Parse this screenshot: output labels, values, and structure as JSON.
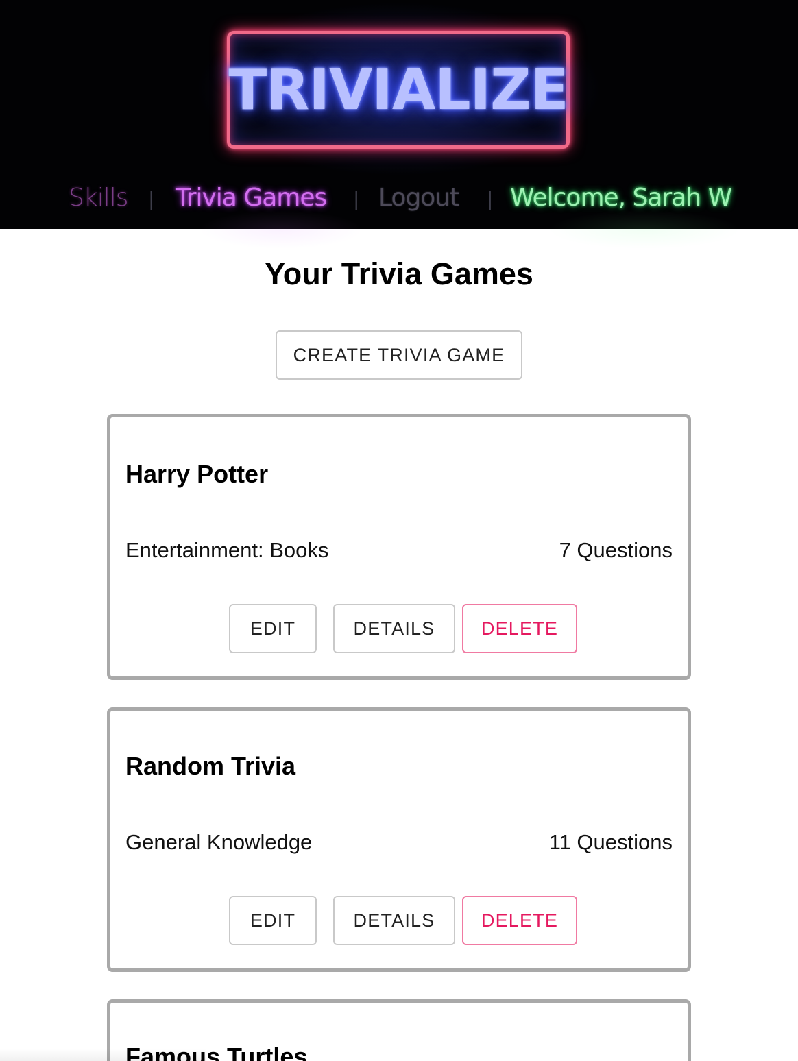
{
  "header": {
    "logo_text": "TRIVIALIZE",
    "nav": {
      "skills": "Skills",
      "trivia_games": "Trivia Games",
      "logout": "Logout",
      "welcome": "Welcome, Sarah W",
      "separator": "|"
    },
    "colors": {
      "logo_border": "#f06a89",
      "logo_text": "#b8c0ff",
      "trivia_games_active": "#d36ef0",
      "welcome": "#9df2b2"
    }
  },
  "main": {
    "title": "Your Trivia Games",
    "create_button": "CREATE TRIVIA GAME",
    "games": [
      {
        "title": "Harry Potter",
        "category": "Entertainment: Books",
        "questions": "7 Questions",
        "edit": "EDIT",
        "details": "DETAILS",
        "delete": "DELETE"
      },
      {
        "title": "Random Trivia",
        "category": "General Knowledge",
        "questions": "11 Questions",
        "edit": "EDIT",
        "details": "DETAILS",
        "delete": "DELETE"
      },
      {
        "title": "Famous Turtles"
      }
    ],
    "colors": {
      "delete": "#e5195f",
      "card_border": "#a9a9a9"
    }
  }
}
